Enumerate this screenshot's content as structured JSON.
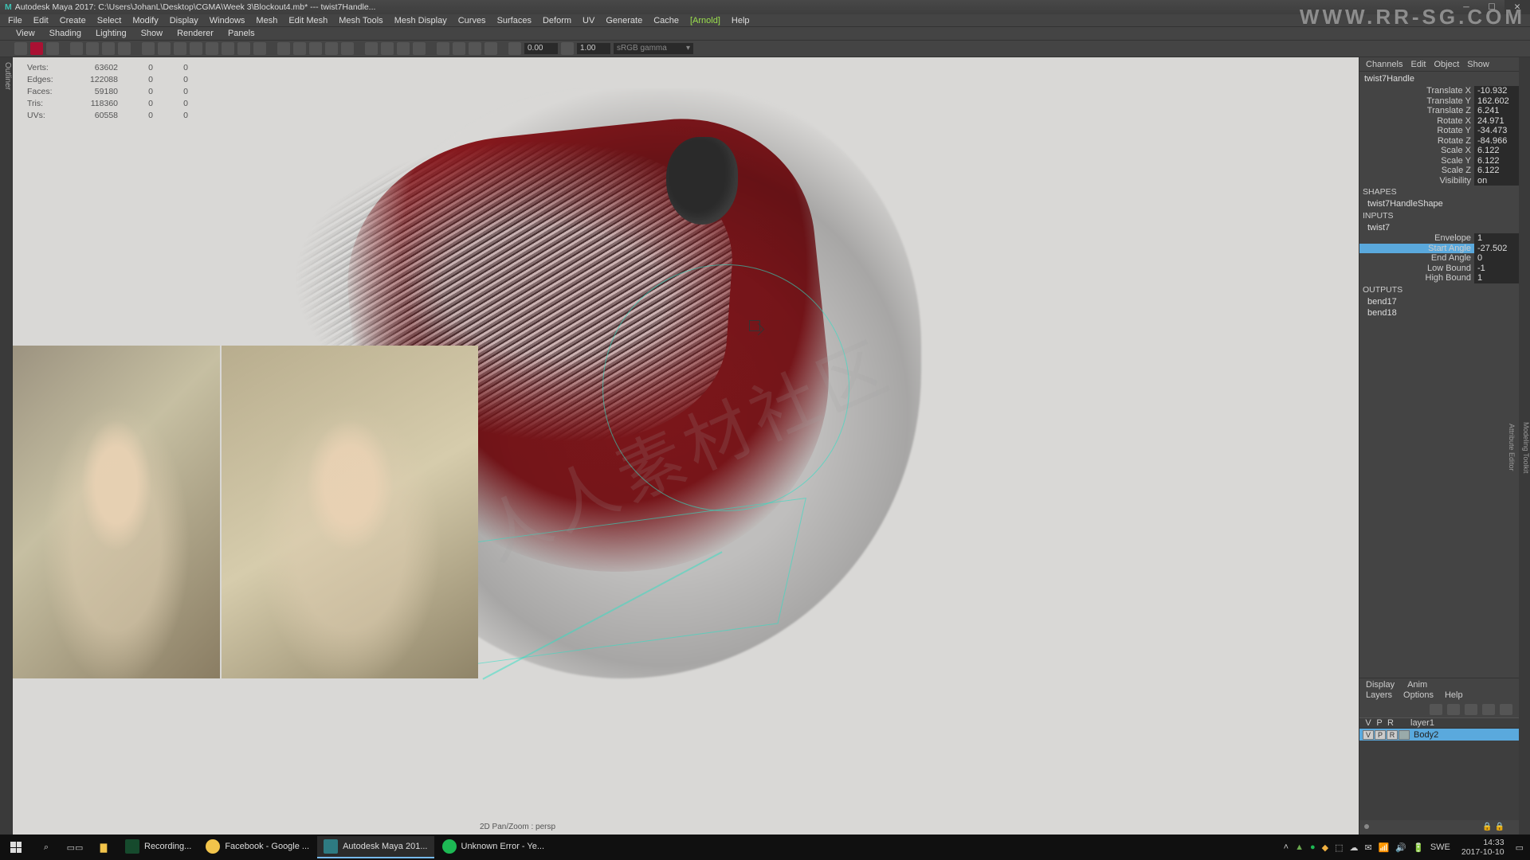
{
  "title": "Autodesk Maya 2017: C:\\Users\\JohanL\\Desktop\\CGMA\\Week 3\\Blockout4.mb*  ---  twist7Handle...",
  "menu": [
    "File",
    "Edit",
    "Create",
    "Select",
    "Modify",
    "Display",
    "Windows",
    "Mesh",
    "Edit Mesh",
    "Mesh Tools",
    "Mesh Display",
    "Curves",
    "Surfaces",
    "Deform",
    "UV",
    "Generate",
    "Cache"
  ],
  "menu_arnold": "[Arnold]",
  "menu_help": "Help",
  "panelmenu": [
    "View",
    "Shading",
    "Lighting",
    "Show",
    "Renderer",
    "Panels"
  ],
  "shelf": {
    "num1": "0.00",
    "num2": "1.00",
    "dd": "sRGB gamma"
  },
  "hud": {
    "rows": [
      {
        "l": "Verts:",
        "v1": "63602",
        "v2": "0",
        "v3": "0"
      },
      {
        "l": "Edges:",
        "v1": "122088",
        "v2": "0",
        "v3": "0"
      },
      {
        "l": "Faces:",
        "v1": "59180",
        "v2": "0",
        "v3": "0"
      },
      {
        "l": "Tris:",
        "v1": "118360",
        "v2": "0",
        "v3": "0"
      },
      {
        "l": "UVs:",
        "v1": "60558",
        "v2": "0",
        "v3": "0"
      }
    ],
    "bottom": "2D Pan/Zoom : persp"
  },
  "outliner_tab": "Outliner",
  "cbox": {
    "tabs": [
      "Channels",
      "Edit",
      "Object",
      "Show"
    ],
    "node": "twist7Handle",
    "attrs": [
      {
        "l": "Translate X",
        "v": "-10.932"
      },
      {
        "l": "Translate Y",
        "v": "162.602"
      },
      {
        "l": "Translate Z",
        "v": "6.241"
      },
      {
        "l": "Rotate X",
        "v": "24.971"
      },
      {
        "l": "Rotate Y",
        "v": "-34.473"
      },
      {
        "l": "Rotate Z",
        "v": "-84.966"
      },
      {
        "l": "Scale X",
        "v": "6.122"
      },
      {
        "l": "Scale Y",
        "v": "6.122"
      },
      {
        "l": "Scale Z",
        "v": "6.122"
      },
      {
        "l": "Visibility",
        "v": "on"
      }
    ],
    "shapes_lbl": "SHAPES",
    "shape_node": "twist7HandleShape",
    "inputs_lbl": "INPUTS",
    "input_node": "twist7",
    "input_attrs": [
      {
        "l": "Envelope",
        "v": "1",
        "hl": false
      },
      {
        "l": "Start Angle",
        "v": "-27.502",
        "hl": true
      },
      {
        "l": "End Angle",
        "v": "0",
        "hl": false
      },
      {
        "l": "Low Bound",
        "v": "-1",
        "hl": false
      },
      {
        "l": "High Bound",
        "v": "1",
        "hl": false
      }
    ],
    "outputs_lbl": "OUTPUTS",
    "output_nodes": [
      "bend17",
      "bend18"
    ]
  },
  "display_tabs": [
    "Display",
    "Anim"
  ],
  "layer_menu": [
    "Layers",
    "Options",
    "Help"
  ],
  "layer_hdr": [
    "V",
    "P",
    "R"
  ],
  "layer_hdr_name": "layer1",
  "layer_row": {
    "c": [
      "V",
      "P",
      "R"
    ],
    "color": "#aaa",
    "name": "Body2"
  },
  "taskbar": {
    "tasks": [
      {
        "icon": "#164a2d",
        "label": "Recording..."
      },
      {
        "icon": "#f2c44b",
        "label": "Facebook - Google ...",
        "round": true
      },
      {
        "icon": "#2e7b82",
        "label": "Autodesk Maya 201..."
      },
      {
        "icon": "#1db954",
        "label": "Unknown Error - Ye...",
        "round": true
      }
    ],
    "lang": "SWE",
    "time": "14:33",
    "date": "2017-10-10"
  },
  "watermark": "WWW.RR-SG.COM",
  "watermark_center": "人人素材社区"
}
